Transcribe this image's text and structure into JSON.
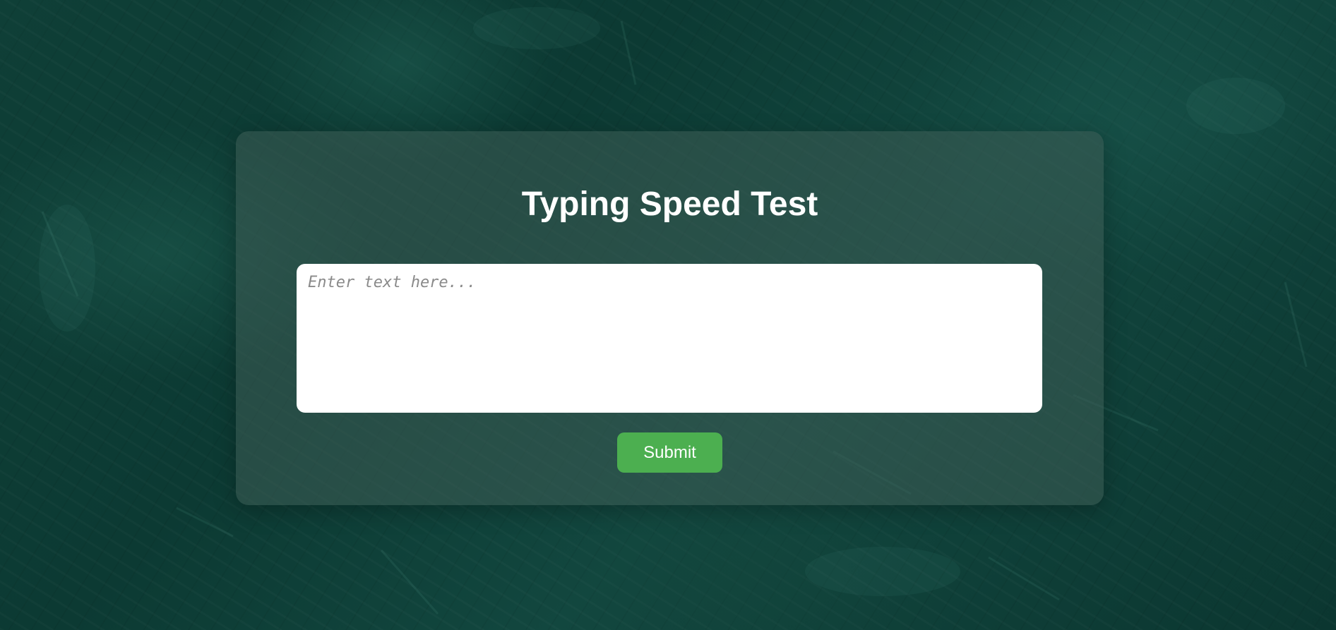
{
  "page": {
    "title": "Typing Speed Test"
  },
  "input": {
    "placeholder": "Enter text here...",
    "value": ""
  },
  "actions": {
    "submit_label": "Submit"
  },
  "colors": {
    "submit_button": "#4caf50",
    "title_text": "#ffffff",
    "background": "#0f3f37"
  }
}
